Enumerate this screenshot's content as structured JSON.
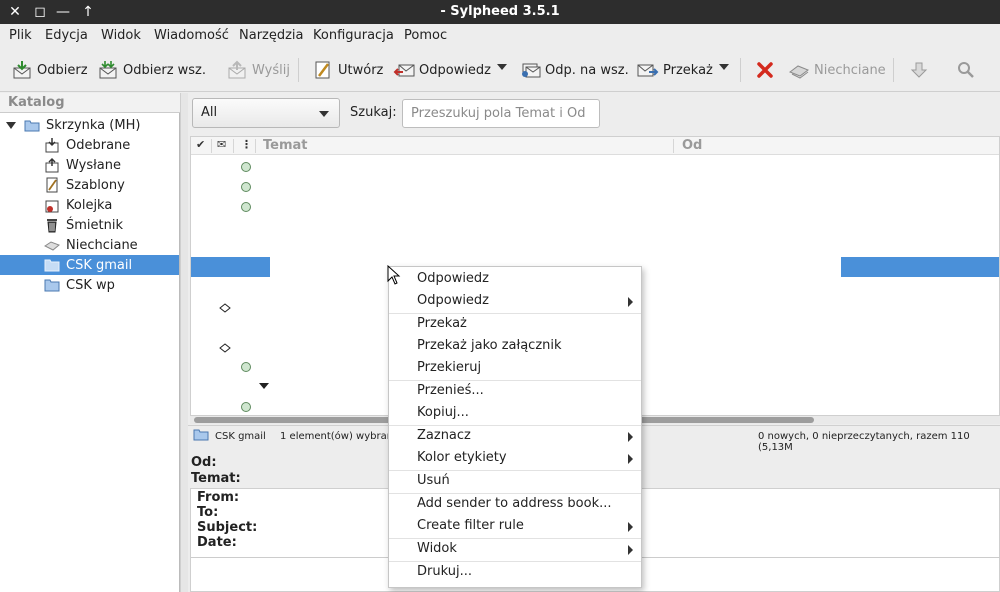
{
  "window": {
    "title": "- Sylpheed 3.5.1",
    "controls": [
      "✕",
      "◻",
      "—",
      "↑"
    ]
  },
  "menubar": [
    "Plik",
    "Edycja",
    "Widok",
    "Wiadomość",
    "Narzędzia",
    "Konfiguracja",
    "Pomoc"
  ],
  "toolbar": {
    "receive": "Odbierz",
    "receive_all": "Odbierz wsz.",
    "send": "Wyślij",
    "compose": "Utwórz",
    "reply": "Odpowiedz",
    "reply_all": "Odp. na wsz.",
    "forward": "Przekaż",
    "junk": "Niechciane"
  },
  "folders": {
    "header": "Katalog",
    "items": [
      {
        "label": "Skrzynka (MH)",
        "icon": "mailbox-icon"
      },
      {
        "label": "Odebrane",
        "icon": "inbox-icon"
      },
      {
        "label": "Wysłane",
        "icon": "outbox-icon"
      },
      {
        "label": "Szablony",
        "icon": "templates-icon"
      },
      {
        "label": "Kolejka",
        "icon": "queue-icon"
      },
      {
        "label": "Śmietnik",
        "icon": "trash-icon"
      },
      {
        "label": "Niechciane",
        "icon": "junk-icon"
      },
      {
        "label": "CSK gmail",
        "icon": "folder-icon"
      },
      {
        "label": "CSK wp",
        "icon": "folder-icon"
      }
    ]
  },
  "filter": {
    "selected": "All",
    "search_label": "Szukaj:",
    "search_placeholder": "Przeszukuj pola Temat i Od"
  },
  "columns": {
    "mark": "✔",
    "status": "✉",
    "attach": "⋮",
    "subject": "Temat",
    "from": "Od"
  },
  "statusbar": {
    "folder": "CSK gmail",
    "selection": "1 element(ów) wybran",
    "counts": "0 nowych, 0 nieprzeczytanych, razem 110 (5,13M"
  },
  "message_header": {
    "from_label": "Od:",
    "subject_label": "Temat:"
  },
  "preview": {
    "from": "From:",
    "to": "To:",
    "subject": "Subject:",
    "date": "Date:"
  },
  "context_menu": [
    {
      "label": "Odpowiedz",
      "submenu": false
    },
    {
      "label": "Odpowiedz",
      "submenu": true
    },
    {
      "label": "Przekaż",
      "submenu": false
    },
    {
      "label": "Przekaż jako załącznik",
      "submenu": false
    },
    {
      "label": "Przekieruj",
      "submenu": false
    },
    {
      "label": "Przenieś...",
      "submenu": false
    },
    {
      "label": "Kopiuj...",
      "submenu": false
    },
    {
      "label": "Zaznacz",
      "submenu": true
    },
    {
      "label": "Kolor etykiety",
      "submenu": true
    },
    {
      "label": "Usuń",
      "submenu": false
    },
    {
      "label": "Add sender to address book...",
      "submenu": false
    },
    {
      "label": "Create filter rule",
      "submenu": true
    },
    {
      "label": "Widok",
      "submenu": true
    },
    {
      "label": "Drukuj...",
      "submenu": false
    }
  ],
  "colors": {
    "selection": "#4a90d9",
    "titlebar": "#2d2d2d",
    "delete_red": "#d42a1e"
  }
}
